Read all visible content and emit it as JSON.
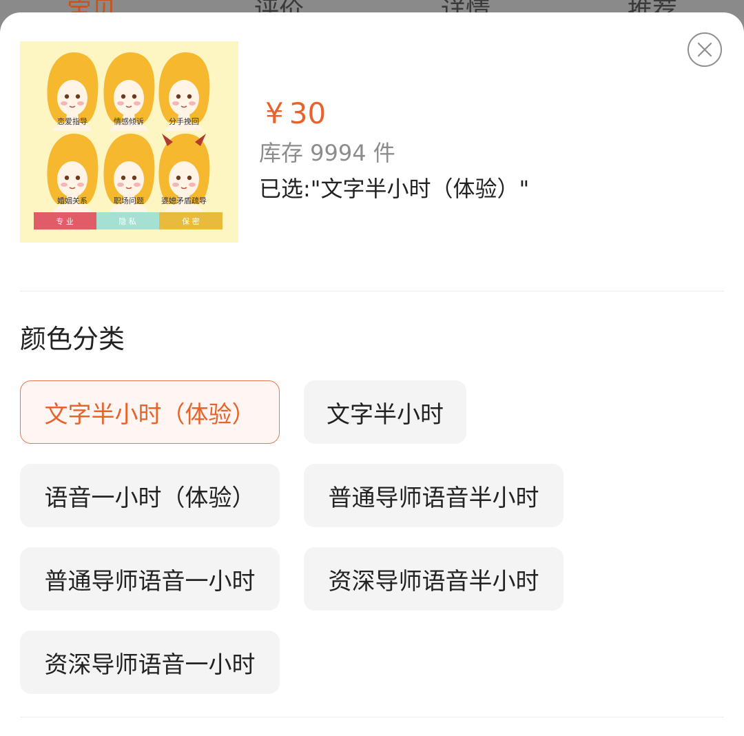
{
  "backdrop_tabs": [
    {
      "label": "宝贝"
    },
    {
      "label": "评价"
    },
    {
      "label": "详情"
    },
    {
      "label": "推荐"
    }
  ],
  "product": {
    "price_symbol": "¥",
    "price": "30",
    "stock": "库存 9994 件",
    "selected_text": "已选:\"文字半小时（体验）\"",
    "image": {
      "faces": [
        {
          "label": "恋爱指导"
        },
        {
          "label": "情感倾诉"
        },
        {
          "label": "分手挽回"
        },
        {
          "label": "婚姻关系"
        },
        {
          "label": "职场问题"
        },
        {
          "label": "婆媳矛盾疏导"
        }
      ],
      "banner": [
        {
          "label": "专 业",
          "color": "#e05c67"
        },
        {
          "label": "隐 私",
          "color": "#a6e0d2"
        },
        {
          "label": "保 密",
          "color": "#e9bb3c"
        }
      ]
    }
  },
  "spec": {
    "title": "颜色分类",
    "options": [
      {
        "label": "文字半小时（体验）",
        "selected": true
      },
      {
        "label": "文字半小时",
        "selected": false
      },
      {
        "label": "语音一小时（体验）",
        "selected": false
      },
      {
        "label": "普通导师语音半小时",
        "selected": false
      },
      {
        "label": "普通导师语音一小时",
        "selected": false
      },
      {
        "label": "资深导师语音半小时",
        "selected": false
      },
      {
        "label": "资深导师语音一小时",
        "selected": false
      }
    ]
  },
  "colors": {
    "accent": "#e8632b",
    "selected_border": "#e27a4e",
    "selected_bg": "#fff6f3",
    "option_bg": "#f4f4f4"
  }
}
